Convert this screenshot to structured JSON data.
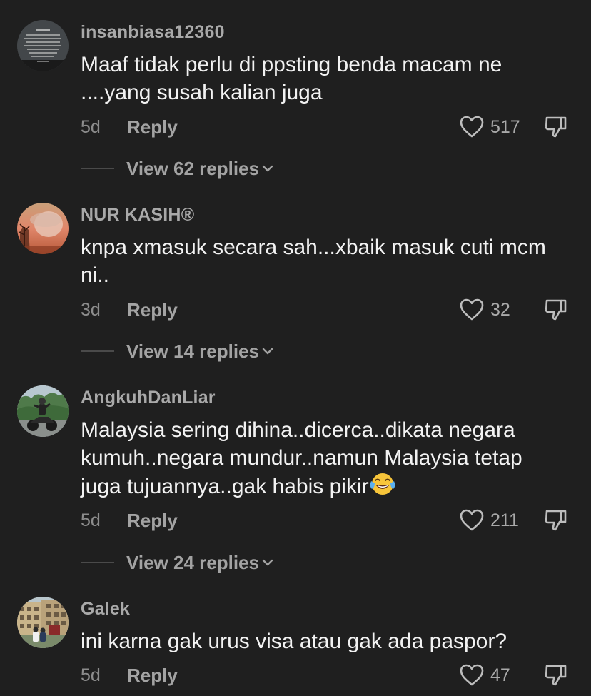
{
  "comments": [
    {
      "username": "insanbiasa12360",
      "text_lines": [
        "Maaf tidak perlu di ppsting benda macam ne",
        "....yang susah kalian juga"
      ],
      "age": "5d",
      "reply_label": "Reply",
      "likes": "517",
      "view_replies": "View 62 replies",
      "avatar_icon": "text-quote-avatar"
    },
    {
      "username": "NUR KASIH®",
      "text_lines": [
        "knpa xmasuk secara sah...xbaik masuk cuti mcm",
        "ni.."
      ],
      "age": "3d",
      "reply_label": "Reply",
      "likes": "32",
      "view_replies": "View 14 replies",
      "avatar_icon": "portrait-sunset-avatar"
    },
    {
      "username": "AngkuhDanLiar",
      "text_lines": [
        "Malaysia sering dihina..dicerca..dikata negara",
        "kumuh..negara mundur..namun Malaysia tetap",
        "juga tujuannya..gak habis pikir"
      ],
      "emoji": "face-with-tears-of-joy",
      "age": "5d",
      "reply_label": "Reply",
      "likes": "211",
      "view_replies": "View 24 replies",
      "avatar_icon": "motorbike-rider-avatar"
    },
    {
      "username": "Galek",
      "text_lines": [
        "ini karna gak urus visa atau gak ada paspor?"
      ],
      "age": "5d",
      "reply_label": "Reply",
      "likes": "47",
      "avatar_icon": "building-couple-avatar"
    }
  ],
  "colors": {
    "background": "#1f1f1f",
    "username": "#a9a9a9",
    "text": "#f2f2f2",
    "meta": "#8c8c8c"
  },
  "icons": {
    "like": "heart-outline-icon",
    "dislike": "thumbs-down-outline-icon",
    "expand": "chevron-down-icon"
  }
}
